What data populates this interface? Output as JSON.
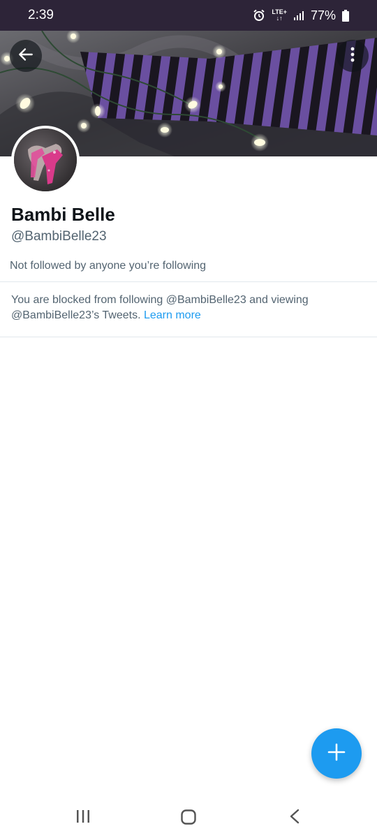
{
  "status_bar": {
    "time": "2:39",
    "network": "LTE+",
    "battery": "77%"
  },
  "profile": {
    "display_name": "Bambi Belle",
    "handle": "@BambiBelle23",
    "followed_by": "Not followed by anyone you’re following"
  },
  "blocked_notice": {
    "text": "You are blocked from following @BambiBelle23 and viewing @BambiBelle23’s Tweets.",
    "link_label": "Learn more"
  },
  "icons": {
    "back": "arrow-left-icon",
    "more": "more-vertical-icon",
    "compose": "plus-icon",
    "nav_recent": "recent-apps-icon",
    "nav_home": "home-icon",
    "nav_back": "chevron-left-icon"
  },
  "colors": {
    "status_bar": "#2d2438",
    "accent": "#1d9bf0",
    "primary_text": "#0f1419",
    "secondary_text": "#536471",
    "divider": "#e1e8ed"
  }
}
